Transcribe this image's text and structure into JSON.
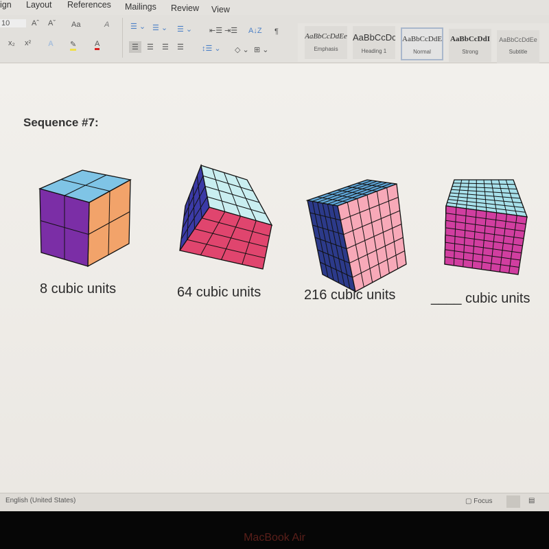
{
  "menu_tabs": [
    "ign",
    "Layout",
    "References",
    "Mailings",
    "Review",
    "View"
  ],
  "ribbon": {
    "font_size": "10",
    "grow_font": "Aˆ",
    "shrink_font": "Aˇ",
    "change_case": "Aa",
    "clear_format": "A",
    "subscript": "x₂",
    "superscript": "x²",
    "text_effects": "A",
    "highlight": "✎",
    "font_color": "A",
    "pilcrow": "¶",
    "sort": "A↓Z"
  },
  "styles": [
    {
      "preview": "AaBbCcDdEe",
      "name": "Emphasis"
    },
    {
      "preview": "AaBbCcDc",
      "name": "Heading 1"
    },
    {
      "preview": "AaBbCcDdE",
      "name": "Normal",
      "selected": true
    },
    {
      "preview": "AaBbCcDdI",
      "name": "Strong"
    },
    {
      "preview": "AaBbCcDdEe",
      "name": "Subtitle"
    }
  ],
  "document": {
    "heading": "Sequence #7:",
    "cubes": [
      {
        "grid_size": 2,
        "caption": "8 cubic units",
        "colors": {
          "top": "#7fc4e6",
          "front": "#7b2ea6",
          "side": "#f2a36a"
        }
      },
      {
        "grid_size": 4,
        "caption": "64 cubic units",
        "colors": {
          "top": "#c9eef0",
          "front": "#e0456e",
          "side": "#3b3aa6"
        }
      },
      {
        "grid_size": 6,
        "caption": "216 cubic units",
        "colors": {
          "top": "#5fa6d8",
          "front": "#f7a9b8",
          "side": "#2c3a8a"
        }
      },
      {
        "grid_size": 8,
        "caption": "cubic units",
        "blank": "____",
        "colors": {
          "top": "#a7e0ea",
          "front": "#d13ea0",
          "side": "#a7e0ea"
        }
      }
    ]
  },
  "status": {
    "language": "English (United States)",
    "focus": "Focus"
  },
  "bezel": {
    "brand": "MacBook Air"
  }
}
